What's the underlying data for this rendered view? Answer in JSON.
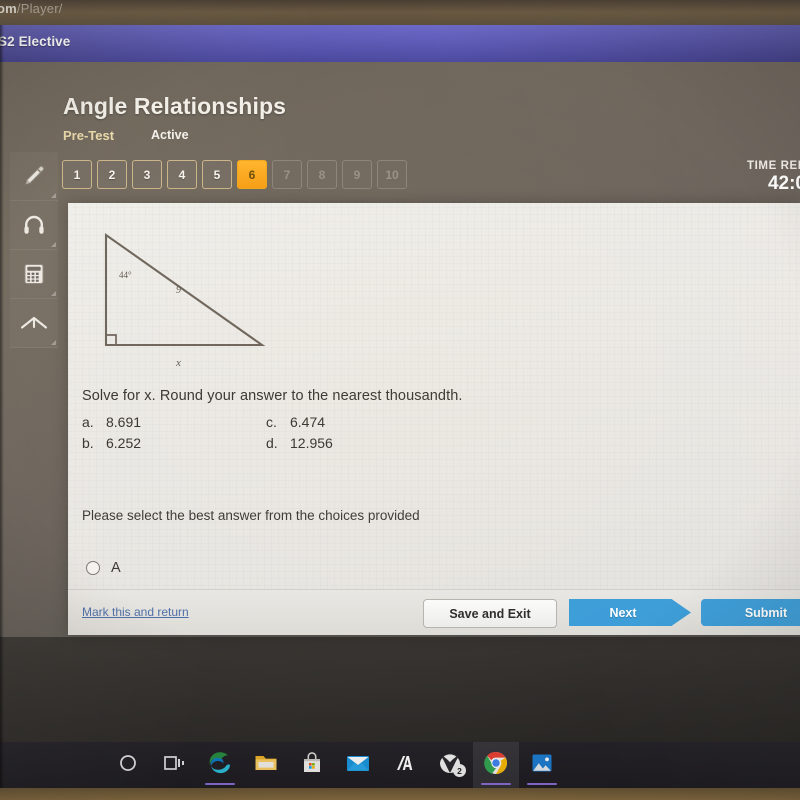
{
  "browser": {
    "url_fragment_dim": "om",
    "url_fragment_rest": "/Player/"
  },
  "app_header": {
    "course_name": "S2 Elective",
    "test_title": "Angle Relationships",
    "test_stage": "Pre-Test",
    "test_status": "Active",
    "timer_label": "TIME REM",
    "timer_value": "42:0",
    "accent_purple": "#5956bd",
    "accent_orange": "#f79c10",
    "accent_blue": "#3c9dd8"
  },
  "tools": [
    {
      "name": "pencil-tool",
      "icon": "pencil-icon"
    },
    {
      "name": "audio-tool",
      "icon": "headphones-icon"
    },
    {
      "name": "calculator-tool",
      "icon": "calculator-icon"
    },
    {
      "name": "reference-tool",
      "icon": "up-arrow-icon"
    }
  ],
  "question_nav": [
    {
      "label": "1",
      "state": "visited"
    },
    {
      "label": "2",
      "state": "visited"
    },
    {
      "label": "3",
      "state": "visited"
    },
    {
      "label": "4",
      "state": "visited"
    },
    {
      "label": "5",
      "state": "visited"
    },
    {
      "label": "6",
      "state": "current"
    },
    {
      "label": "7",
      "state": "locked"
    },
    {
      "label": "8",
      "state": "locked"
    },
    {
      "label": "9",
      "state": "locked"
    },
    {
      "label": "10",
      "state": "locked"
    }
  ],
  "figure": {
    "shape": "right-triangle",
    "angle_label": "44°",
    "hypotenuse_label": "9",
    "base_label": "x",
    "right_angle_marker": true
  },
  "question": {
    "prompt": "Solve for x. Round your answer to the nearest thousandth.",
    "choices": [
      {
        "key": "a.",
        "value": "8.691"
      },
      {
        "key": "b.",
        "value": "6.252"
      },
      {
        "key": "c.",
        "value": "6.474"
      },
      {
        "key": "d.",
        "value": "12.956"
      }
    ],
    "select_note": "Please select the best answer from the choices provided",
    "answer_options": [
      {
        "label": "A",
        "selected": false
      }
    ]
  },
  "footer": {
    "mark_link": "Mark this and return",
    "save_button": "Save and Exit",
    "next_button": "Next",
    "submit_button": "Submit"
  },
  "taskbar": [
    {
      "name": "cortana-icon",
      "glyph": "circle",
      "state": "idle"
    },
    {
      "name": "task-view-icon",
      "glyph": "taskview",
      "state": "idle"
    },
    {
      "name": "edge-browser-icon",
      "glyph": "edge",
      "state": "running"
    },
    {
      "name": "file-explorer-icon",
      "glyph": "folder",
      "state": "idle"
    },
    {
      "name": "microsoft-store-icon",
      "glyph": "store",
      "state": "idle"
    },
    {
      "name": "mail-icon",
      "glyph": "mail",
      "state": "idle"
    },
    {
      "name": "media-app-icon",
      "glyph": "slashA",
      "state": "idle"
    },
    {
      "name": "xbox-icon",
      "glyph": "xbox",
      "state": "idle",
      "badge": "2"
    },
    {
      "name": "chrome-browser-icon",
      "glyph": "chrome",
      "state": "active"
    },
    {
      "name": "photos-icon",
      "glyph": "photos",
      "state": "running"
    }
  ]
}
